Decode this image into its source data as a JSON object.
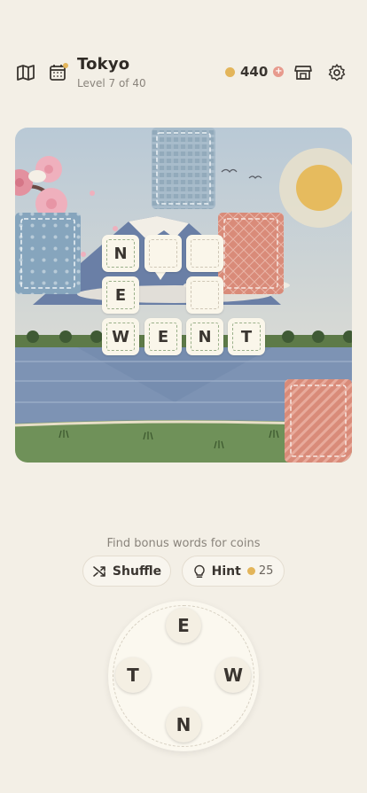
{
  "header": {
    "city": "Tokyo",
    "level_text": "Level 7 of 40",
    "coins": "440",
    "coin_plus": "+"
  },
  "grid": {
    "tiles": [
      {
        "letter": "N"
      },
      {
        "letter": ""
      },
      {
        "letter": ""
      },
      {
        "letter": "E"
      },
      {
        "letter": ""
      },
      {
        "letter": "W"
      },
      {
        "letter": "E"
      },
      {
        "letter": "N"
      },
      {
        "letter": "T"
      }
    ]
  },
  "bonus_text": "Find bonus words for coins",
  "actions": {
    "shuffle_label": "Shuffle",
    "hint_label": "Hint",
    "hint_cost": "25"
  },
  "wheel": {
    "letters": [
      "E",
      "W",
      "N",
      "T"
    ]
  },
  "colors": {
    "background": "#f3efe6",
    "coin": "#e3b55a",
    "accent_red": "#d98b79",
    "accent_blue": "#8aa8bd"
  }
}
